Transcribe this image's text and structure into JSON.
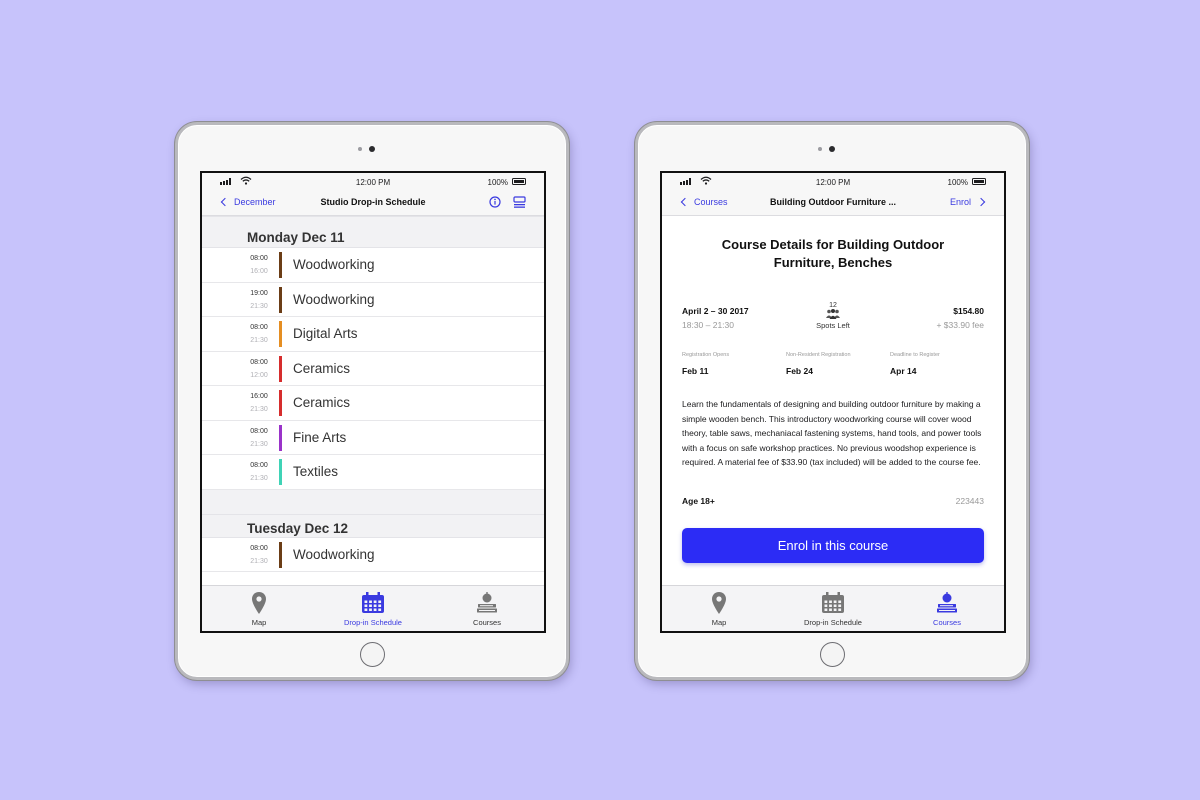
{
  "colors": {
    "background": "#c7c3fb",
    "accent": "#3a3ae0",
    "button": "#2c2cf5",
    "woodworking": "#6b3d16",
    "digital_arts": "#e58e22",
    "ceramics": "#d62d2d",
    "fine_arts": "#9a33c9",
    "textiles": "#3fd3b6"
  },
  "status": {
    "time": "12:00 PM",
    "battery": "100%"
  },
  "left": {
    "nav": {
      "back_label": "December",
      "title": "Studio Drop-in Schedule",
      "info_icon": "info-icon",
      "list_icon": "list-icon"
    },
    "days": [
      {
        "header": "Monday Dec 11",
        "sessions": [
          {
            "start": "08:00",
            "end": "16:00",
            "name": "Woodworking",
            "color": "#6b3d16"
          },
          {
            "start": "19:00",
            "end": "21:30",
            "name": "Woodworking",
            "color": "#6b3d16"
          },
          {
            "start": "08:00",
            "end": "21:30",
            "name": "Digital Arts",
            "color": "#e58e22"
          },
          {
            "start": "08:00",
            "end": "12:00",
            "name": "Ceramics",
            "color": "#d62d2d"
          },
          {
            "start": "16:00",
            "end": "21:30",
            "name": "Ceramics",
            "color": "#d62d2d"
          },
          {
            "start": "08:00",
            "end": "21:30",
            "name": "Fine Arts",
            "color": "#9a33c9"
          },
          {
            "start": "08:00",
            "end": "21:30",
            "name": "Textiles",
            "color": "#3fd3b6"
          }
        ]
      },
      {
        "header": "Tuesday Dec 12",
        "sessions": [
          {
            "start": "08:00",
            "end": "21:30",
            "name": "Woodworking",
            "color": "#6b3d16"
          }
        ]
      }
    ]
  },
  "right": {
    "nav": {
      "back_label": "Courses",
      "title": "Building Outdoor Furniture ...",
      "action_label": "Enrol"
    },
    "course": {
      "title": "Course Details for Building Outdoor Furniture, Benches",
      "date": "April 2 – 30 2017",
      "time": "18:30 – 21:30",
      "spots_count": "12",
      "spots_label": "Spots Left",
      "price": "$154.80",
      "fee": "+ $33.90 fee",
      "registration": [
        {
          "label": "Registration Opens",
          "value": "Feb 11"
        },
        {
          "label": "Non-Resident Registration",
          "value": "Feb 24"
        },
        {
          "label": "Deadline to Register",
          "value": "Apr 14"
        }
      ],
      "description": "Learn the fundamentals of designing and building outdoor furniture by making a simple wooden bench. This introductory woodworking course will cover wood theory, table saws, mechaniacal fastening systems, hand tools, and power tools with a focus on safe workshop practices. No previous woodshop experience is required. A material fee of $33.90 (tax included) will be added to the course fee.",
      "age": "Age 18+",
      "code": "223443",
      "enrol_button": "Enrol in this course"
    }
  },
  "tabs": [
    {
      "label": "Map",
      "icon": "map-pin-icon"
    },
    {
      "label": "Drop-in Schedule",
      "icon": "calendar-icon"
    },
    {
      "label": "Courses",
      "icon": "apple-books-icon"
    }
  ],
  "left_active_tab": 1,
  "right_active_tab": 2
}
